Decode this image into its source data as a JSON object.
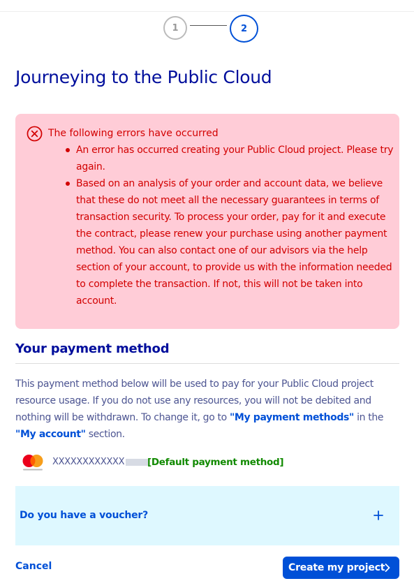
{
  "stepper": {
    "steps": [
      "1",
      "2"
    ],
    "active_step": 2
  },
  "page_title": "Journeying to the Public Cloud",
  "error_box": {
    "icon": "error-circle-x-icon",
    "heading": "The following errors have occurred",
    "items": [
      "An error has occurred creating your Public Cloud project. Please try again.",
      "Based on an analysis of your order and account data, we believe that these do not meet all the necessary guarantees in terms of transaction security. To process your order, pay for it and execute the contract, please renew your purchase using another payment method. You can also contact one of our advisors via the help section of your account, to provide us with the information needed to complete the transaction. If not, this will not be taken into account."
    ]
  },
  "payment": {
    "title": "Your payment method",
    "desc_part1": "This payment method below will be used to pay for your Public Cloud project resource usage. If you do not use any resources, you will not be debited and nothing will be withdrawn. To change it, go to ",
    "link_payment_methods": "\"My payment methods\"",
    "desc_part2": " in the ",
    "link_my_account": "\"My account\"",
    "desc_part3": " section.",
    "card": {
      "brand": "mastercard",
      "logo_icon": "mastercard-logo-icon",
      "number_masked": "XXXXXXXXXXXX",
      "default_label": "[Default payment method]"
    }
  },
  "voucher": {
    "label": "Do you have a voucher?",
    "icon": "plus-icon"
  },
  "actions": {
    "cancel_label": "Cancel",
    "create_label": "Create my project"
  },
  "colors": {
    "primary": "#0050d7",
    "title": "#000e9c",
    "error_bg": "#ffccd7",
    "error_text": "#d20000",
    "success": "#118a00",
    "voucher_bg": "#def8ff"
  }
}
